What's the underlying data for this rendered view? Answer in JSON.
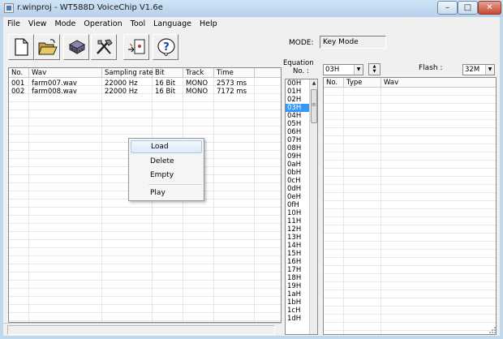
{
  "window": {
    "title": "r.winproj - WT588D VoiceChip V1.6e",
    "min": "–",
    "max": "□",
    "close": "✕"
  },
  "menu": [
    "File",
    "View",
    "Mode",
    "Operation",
    "Tool",
    "Language",
    "Help"
  ],
  "toolbar": {
    "icons": [
      "new-file-icon",
      "open-folder-icon",
      "voice-chip-icon",
      "tools-icon",
      "load-to-chip-icon",
      "help-icon"
    ],
    "mode_label": "MODE:",
    "mode_value": "Key Mode"
  },
  "wav_table": {
    "columns": [
      "No.",
      "Wav",
      "Sampling rate",
      "Bit",
      "Track",
      "Time"
    ],
    "rows": [
      [
        "001",
        "farm007.wav",
        "22000 Hz",
        "16 Bit",
        "MONO",
        "2573 ms"
      ],
      [
        "002",
        "farm008.wav",
        "22000 Hz",
        "16 Bit",
        "MONO",
        "7172 ms"
      ]
    ]
  },
  "context_menu": {
    "items": [
      "Load",
      "Delete",
      "Empty",
      "Play"
    ],
    "highlighted": "Load"
  },
  "equation": {
    "label_line1": "Equation",
    "label_line2": "No. :",
    "selected": "03H",
    "combo_value": "03H",
    "items": [
      "00H",
      "01H",
      "02H",
      "03H",
      "04H",
      "05H",
      "06H",
      "07H",
      "08H",
      "09H",
      "0aH",
      "0bH",
      "0cH",
      "0dH",
      "0eH",
      "0fH",
      "10H",
      "11H",
      "12H",
      "13H",
      "14H",
      "15H",
      "16H",
      "17H",
      "18H",
      "19H",
      "1aH",
      "1bH",
      "1cH",
      "1dH"
    ]
  },
  "flash": {
    "label": "Flash :",
    "value": "32M"
  },
  "eq_table": {
    "columns": [
      "No.",
      "Type",
      "Wav"
    ]
  },
  "colors": {
    "selection": "#3399ff",
    "titlebar": "#b9d3ee",
    "close": "#c74a32"
  }
}
